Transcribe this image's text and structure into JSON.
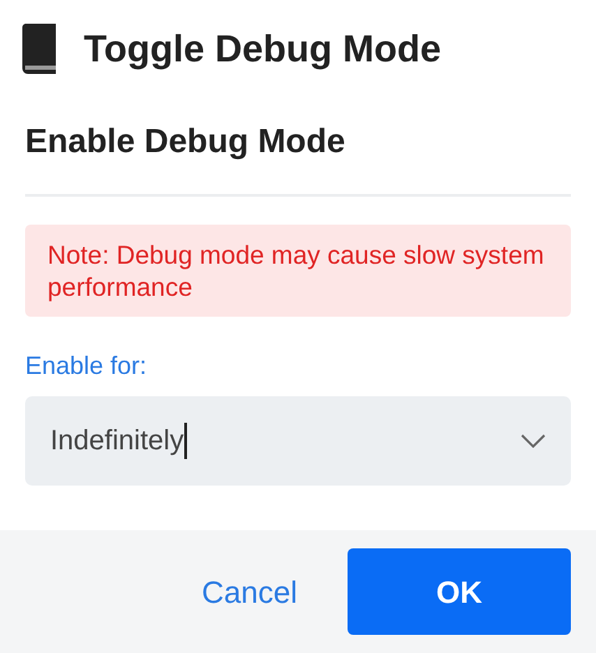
{
  "window": {
    "title": "Toggle Debug Mode"
  },
  "dialog": {
    "heading": "Enable Debug Mode",
    "alert": {
      "kind": "danger",
      "text": "Note: Debug mode may cause slow system performance"
    },
    "field": {
      "label": "Enable for:",
      "value": "Indefinitely",
      "focused": true
    },
    "buttons": [
      {
        "kind": "link",
        "label": "Cancel"
      },
      {
        "kind": "primary",
        "label": "OK"
      }
    ]
  }
}
